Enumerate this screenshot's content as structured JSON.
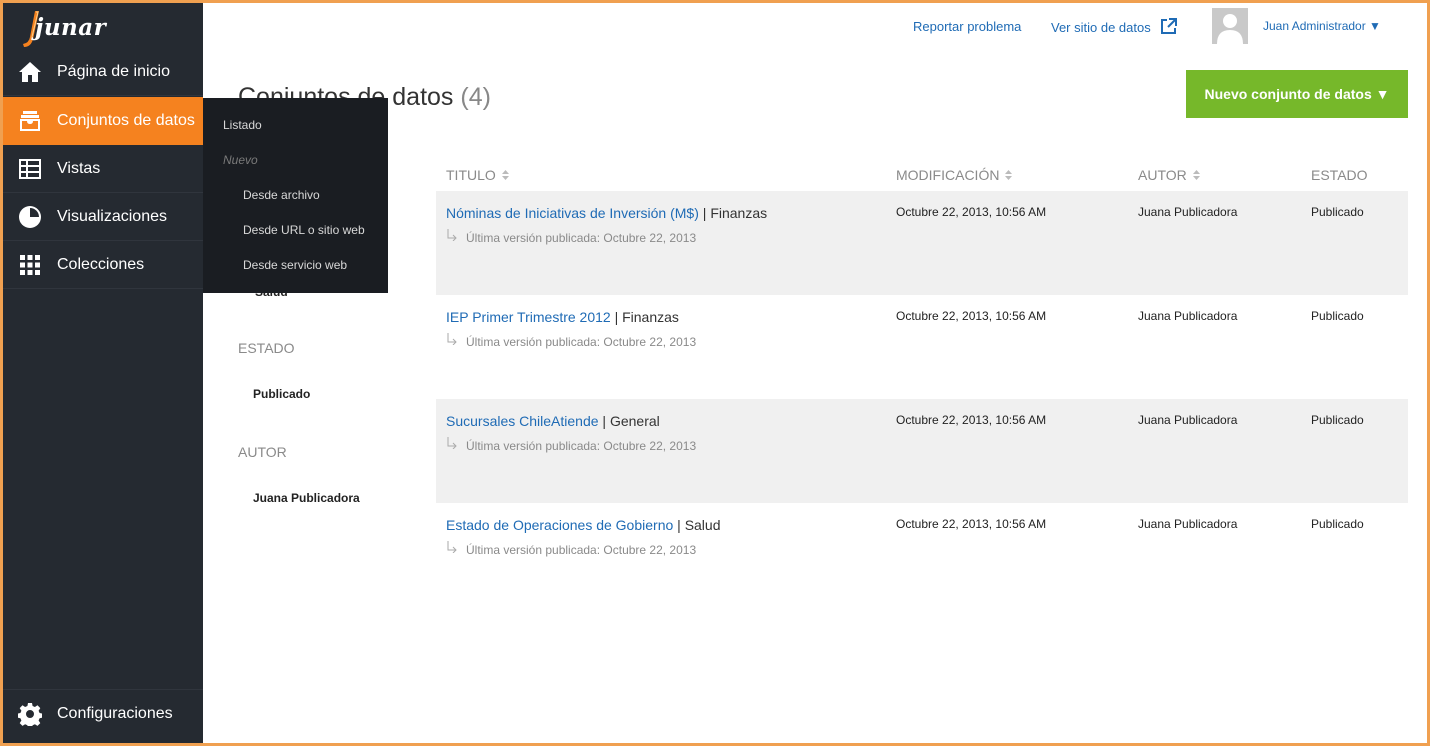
{
  "brand": {
    "logo_text": "junar"
  },
  "sidebar": {
    "items": [
      {
        "label": "Página de inicio"
      },
      {
        "label": "Conjuntos de datos"
      },
      {
        "label": "Vistas"
      },
      {
        "label": "Visualizaciones"
      },
      {
        "label": "Colecciones"
      }
    ],
    "settings_label": "Configuraciones"
  },
  "submenu": {
    "listado": "Listado",
    "nuevo_heading": "Nuevo",
    "desde_archivo": "Desde archivo",
    "desde_url": "Desde URL o sitio web",
    "desde_servicio": "Desde servicio web"
  },
  "topbar": {
    "report_problem": "Reportar problema",
    "view_site": "Ver sitio de datos",
    "user_name": "Juan Administrador ▼"
  },
  "page": {
    "title": "Conjuntos de datos",
    "count": "(4)",
    "new_button": "Nuevo conjunto de datos ▼"
  },
  "filters": {
    "estado_heading": "ESTADO",
    "estado_value": "Publicado",
    "autor_heading": "AUTOR",
    "autor_value": "Juana Publicadora",
    "hidden_fragment": "Salud"
  },
  "table": {
    "headers": {
      "titulo": "TITULO",
      "modificacion": "MODIFICACIÓN",
      "autor": "AUTOR",
      "estado": "ESTADO"
    },
    "rows": [
      {
        "title": "Nóminas de Iniciativas de Inversión (M$)",
        "category": "Finanzas",
        "sub": "Última versión publicada: Octubre 22, 2013",
        "modified": "Octubre 22, 2013, 10:56 AM",
        "author": "Juana Publicadora",
        "status": "Publicado"
      },
      {
        "title": "IEP Primer Trimestre 2012",
        "category": "Finanzas",
        "sub": "Última versión publicada: Octubre 22, 2013",
        "modified": "Octubre 22, 2013, 10:56 AM",
        "author": "Juana Publicadora",
        "status": "Publicado"
      },
      {
        "title": "Sucursales ChileAtiende",
        "category": "General",
        "sub": "Última versión publicada: Octubre 22, 2013",
        "modified": "Octubre 22, 2013, 10:56 AM",
        "author": "Juana Publicadora",
        "status": "Publicado"
      },
      {
        "title": "Estado de Operaciones de Gobierno",
        "category": "Salud",
        "sub": "Última versión publicada: Octubre 22, 2013",
        "modified": "Octubre 22, 2013, 10:56 AM",
        "author": "Juana Publicadora",
        "status": "Publicado"
      }
    ]
  },
  "colors": {
    "sidebar_bg": "#252a31",
    "active_orange": "#f5821f",
    "button_green": "#76b82a",
    "link_blue": "#1f6bb5",
    "frame_border": "#f0a050"
  }
}
